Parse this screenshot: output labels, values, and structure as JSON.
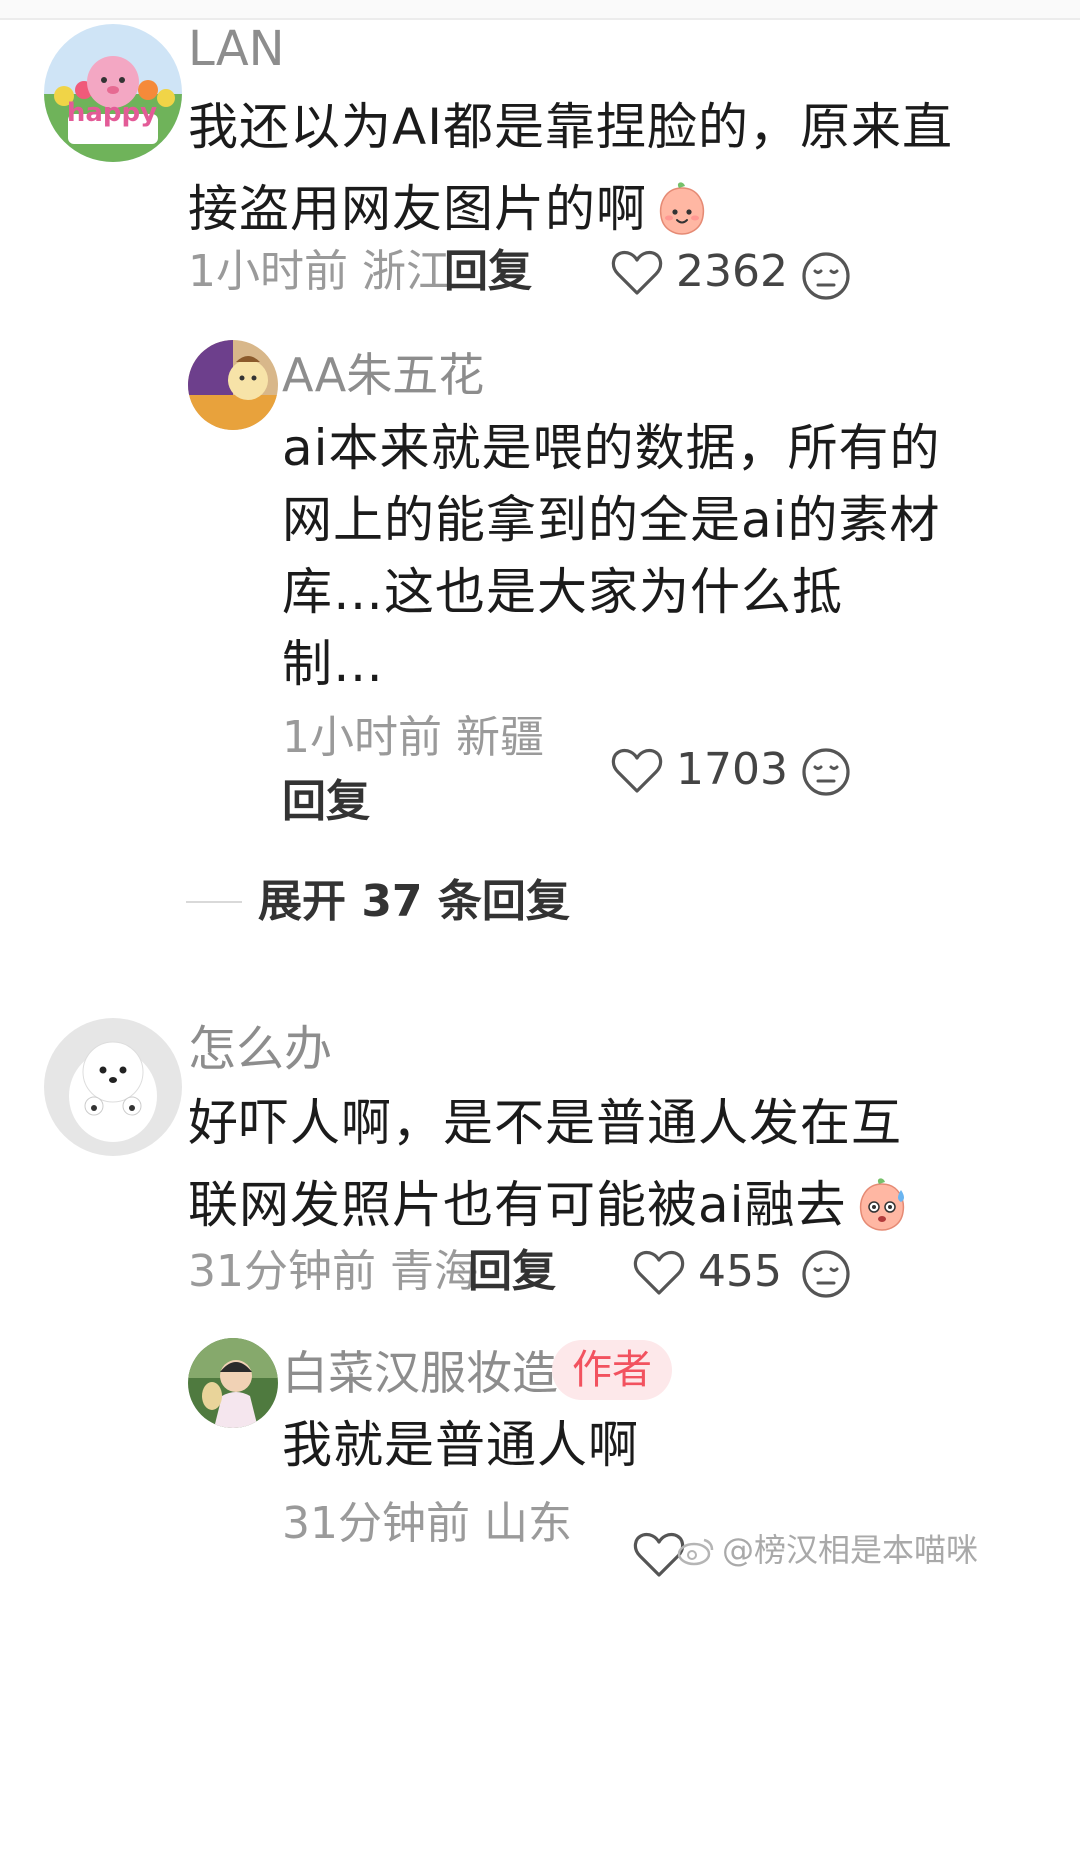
{
  "comments": [
    {
      "username": "LAN",
      "avatar_text": "happy",
      "text_line1": "我还以为AI都是靠捏脸的，原来直",
      "text_line2": "接盗用网友图片的啊",
      "time": "1小时前",
      "location": "浙江",
      "reply_label": "回复",
      "likes": "2362",
      "emoji": "peach-smile-emoji"
    },
    {
      "username": "怎么办",
      "text_line1": "好吓人啊，是不是普通人发在互",
      "text_line2": "联网发照片也有可能被ai融去",
      "time": "31分钟前",
      "location": "青海",
      "reply_label": "回复",
      "likes": "455",
      "emoji": "peach-sweat-emoji"
    }
  ],
  "replies": [
    {
      "username": "AA朱五花",
      "text_line1": "ai本来就是喂的数据，所有的",
      "text_line2": "网上的能拿到的全是ai的素材",
      "text_line3": "库…这也是大家为什么抵",
      "text_line4": "制…",
      "time": "1小时前",
      "location": "新疆",
      "reply_label": "回复",
      "likes": "1703"
    },
    {
      "username": "白菜汉服妆造",
      "badge": "作者",
      "text_line1": "我就是普通人啊",
      "time": "31分钟前",
      "location": "山东"
    }
  ],
  "expand": {
    "label": "展开 37 条回复"
  },
  "watermark": {
    "text": "@榜汉相是本喵咪"
  },
  "colors": {
    "meta_gray": "#9a9a9a",
    "badge_bg": "#fde8ea",
    "badge_text": "#f2525f"
  }
}
